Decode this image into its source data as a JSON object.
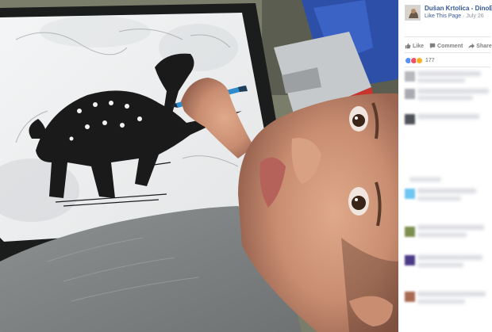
{
  "post": {
    "page_name": "Dušan Krtolica - DinoBoy",
    "like_page_label": "Like This Page",
    "separator": " · ",
    "date": "July 26",
    "options_glyph": "•••"
  },
  "actions": {
    "like": "Like",
    "comment": "Comment",
    "share": "Share"
  },
  "reactions": {
    "count": "177",
    "types": [
      "like-icon",
      "love-icon",
      "wow-icon"
    ],
    "colors": [
      "#5890ff",
      "#f25268",
      "#f7b125"
    ]
  },
  "colors": {
    "link": "#365899",
    "muted": "#90949c"
  }
}
